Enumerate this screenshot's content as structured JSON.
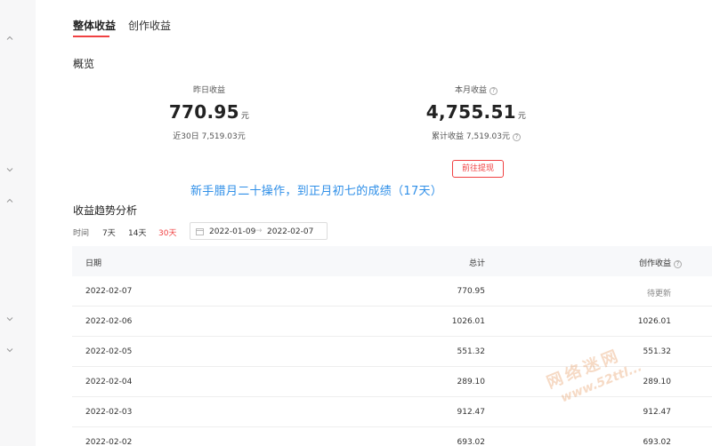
{
  "tabs": [
    {
      "label": "整体收益",
      "active": true
    },
    {
      "label": "创作收益",
      "active": false
    }
  ],
  "overview": {
    "title": "概览",
    "yesterday": {
      "label": "昨日收益",
      "value": "770.95",
      "unit": "元",
      "sub": "近30日 7,519.03元"
    },
    "month": {
      "label": "本月收益",
      "value": "4,755.51",
      "unit": "元",
      "sub": "累计收益 7,519.03元"
    },
    "withdraw_label": "前往提现"
  },
  "annotation": "新手腊月二十操作，到正月初七的成绩（17天）",
  "trend": {
    "title": "收益趋势分析",
    "filter_label": "时间",
    "options": [
      "7天",
      "14天",
      "30天"
    ],
    "active_option": "30天",
    "date_start": "2022-01-09",
    "date_sep": "→",
    "date_end": "2022-02-07"
  },
  "table": {
    "headers": {
      "date": "日期",
      "total": "总计",
      "create": "创作收益"
    },
    "rows": [
      {
        "date": "2022-02-07",
        "total": "770.95",
        "create": "待更新"
      },
      {
        "date": "2022-02-06",
        "total": "1026.01",
        "create": "1026.01"
      },
      {
        "date": "2022-02-05",
        "total": "551.32",
        "create": "551.32"
      },
      {
        "date": "2022-02-04",
        "total": "289.10",
        "create": "289.10"
      },
      {
        "date": "2022-02-03",
        "total": "912.47",
        "create": "912.47"
      },
      {
        "date": "2022-02-02",
        "total": "693.02",
        "create": "693.02"
      }
    ]
  },
  "watermark": {
    "text": "网络迷网",
    "url": "www.52ttl..."
  },
  "colors": {
    "accent": "#f04142",
    "annotation": "#2f8fe8"
  },
  "icons": {
    "help": "question-circle-icon",
    "calendar": "calendar-icon",
    "rail": "chevron-icon"
  }
}
